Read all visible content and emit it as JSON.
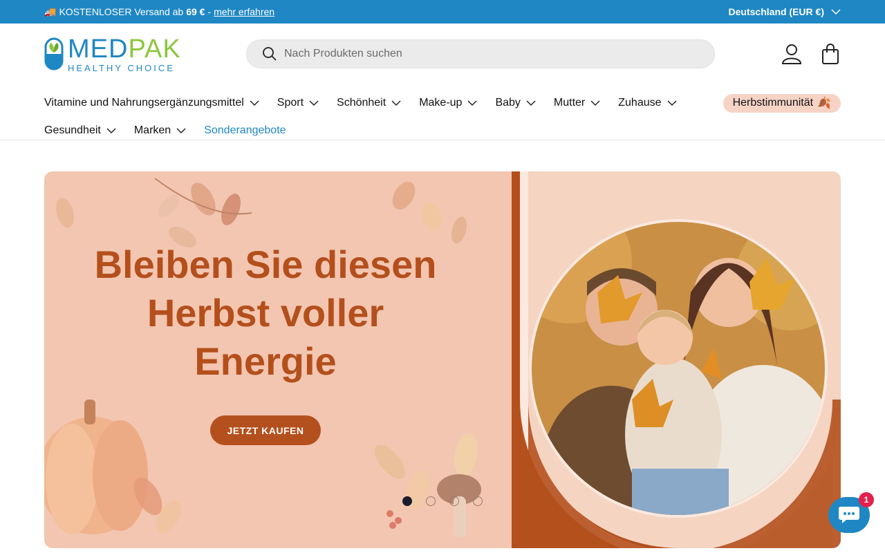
{
  "announcement": {
    "icon": "truck-icon",
    "text_before": "KOSTENLOSER Versand ab",
    "amount": "69 €",
    "separator": "-",
    "link": "mehr erfahren",
    "region": "Deutschland (EUR €)"
  },
  "logo": {
    "brand_part1": "MED",
    "brand_part2": "PAK",
    "tagline": "HEALTHY CHOICE"
  },
  "search": {
    "placeholder": "Nach Produkten suchen"
  },
  "nav": {
    "row1": [
      "Vitamine und Nahrungsergänzungsmittel",
      "Sport",
      "Schönheit",
      "Make-up",
      "Baby",
      "Mutter",
      "Zuhause"
    ],
    "promo": {
      "label": "Herbstimmunität",
      "emoji": "🍂"
    },
    "row2": [
      "Gesundheit",
      "Marken"
    ],
    "sale": "Sonderangebote"
  },
  "hero": {
    "title_lines": [
      "Bleiben Sie diesen",
      "Herbst voller",
      "Energie"
    ],
    "button": "JETZT KAUFEN",
    "slide_count": 4,
    "active_slide": 1
  },
  "chat": {
    "badge": "1"
  },
  "colors": {
    "brand_blue": "#1f87c4",
    "brand_green": "#8dc63f",
    "hero_bg": "#f2c6b1",
    "hero_accent": "#b4501d",
    "badge_red": "#e4214c"
  }
}
